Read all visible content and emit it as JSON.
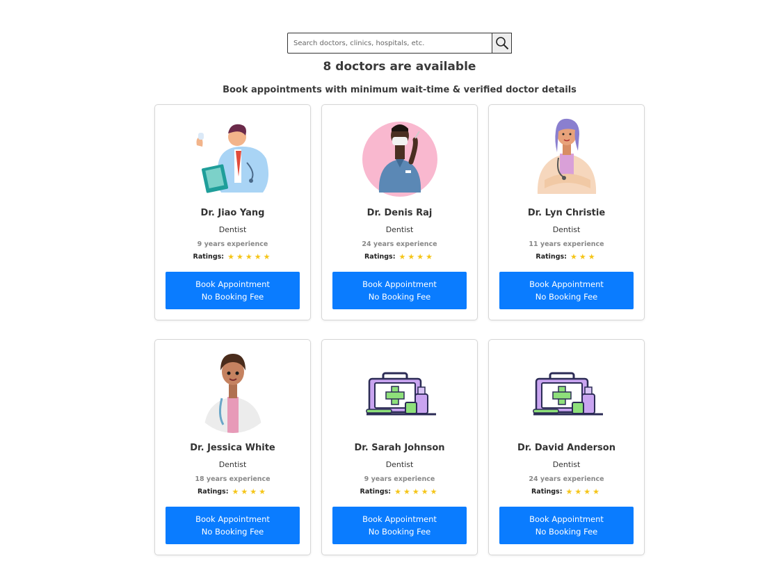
{
  "search": {
    "placeholder": "Search doctors, clinics, hospitals, etc.",
    "value": ""
  },
  "heading": "8 doctors are available",
  "subheading": "Book appointments with minimum wait-time & verified doctor details",
  "ratings_label": "Ratings:",
  "colors": {
    "button": "#0a7cff",
    "star": "#f5c518",
    "text": "#333333",
    "muted": "#888888"
  },
  "doctors": [
    {
      "name": "Dr. Jiao Yang",
      "specialty": "Dentist",
      "experience": "9 years experience",
      "rating": 5,
      "avatar": "male-doctor-clipboard-illustration",
      "button_line1": "Book Appointment",
      "button_line2": "No Booking Fee"
    },
    {
      "name": "Dr. Denis Raj",
      "specialty": "Dentist",
      "experience": "24 years experience",
      "rating": 4,
      "avatar": "masked-doctor-pink-circle-illustration",
      "button_line1": "Book Appointment",
      "button_line2": "No Booking Fee"
    },
    {
      "name": "Dr. Lyn Christie",
      "specialty": "Dentist",
      "experience": "11 years experience",
      "rating": 3,
      "avatar": "female-doctor-arms-crossed-illustration",
      "button_line1": "Book Appointment",
      "button_line2": "No Booking Fee"
    },
    {
      "name": "Dr. Jessica White",
      "specialty": "Dentist",
      "experience": "18 years experience",
      "rating": 4,
      "avatar": "female-doctor-3d-illustration",
      "button_line1": "Book Appointment",
      "button_line2": "No Booking Fee"
    },
    {
      "name": "Dr. Sarah Johnson",
      "specialty": "Dentist",
      "experience": "9 years experience",
      "rating": 5,
      "avatar": "first-aid-kit-icon",
      "button_line1": "Book Appointment",
      "button_line2": "No Booking Fee"
    },
    {
      "name": "Dr. David Anderson",
      "specialty": "Dentist",
      "experience": "24 years experience",
      "rating": 4,
      "avatar": "first-aid-kit-icon",
      "button_line1": "Book Appointment",
      "button_line2": "No Booking Fee"
    }
  ]
}
